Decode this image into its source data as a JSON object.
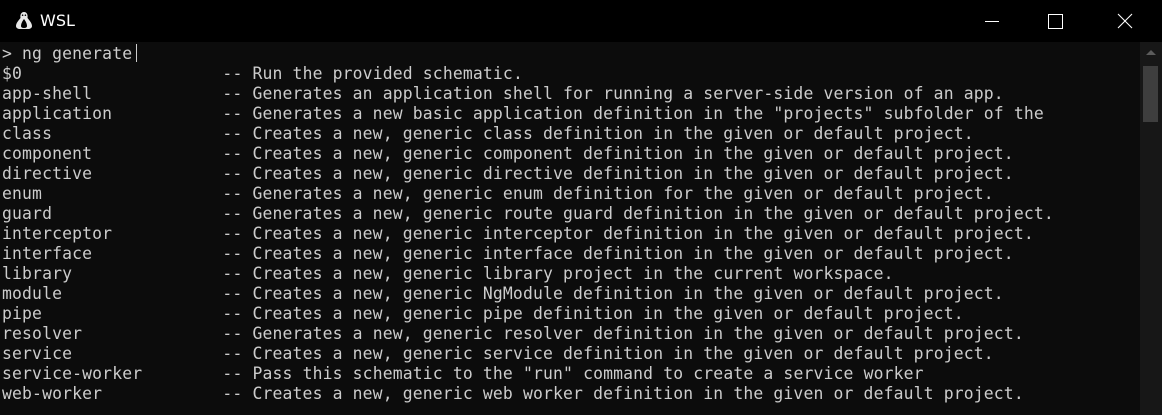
{
  "window": {
    "title": "WSL",
    "icon": "linux-penguin-icon",
    "controls": [
      "minimize",
      "maximize",
      "close"
    ]
  },
  "terminal": {
    "prompt": "> ng generate",
    "completions": [
      {
        "name": "$0",
        "desc": "-- Run the provided schematic."
      },
      {
        "name": "app-shell",
        "desc": "-- Generates an application shell for running a server-side version of an app."
      },
      {
        "name": "application",
        "desc": "-- Generates a new basic application definition in the \"projects\" subfolder of the"
      },
      {
        "name": "class",
        "desc": "-- Creates a new, generic class definition in the given or default project."
      },
      {
        "name": "component",
        "desc": "-- Creates a new, generic component definition in the given or default project."
      },
      {
        "name": "directive",
        "desc": "-- Creates a new, generic directive definition in the given or default project."
      },
      {
        "name": "enum",
        "desc": "-- Generates a new, generic enum definition for the given or default project."
      },
      {
        "name": "guard",
        "desc": "-- Generates a new, generic route guard definition in the given or default project."
      },
      {
        "name": "interceptor",
        "desc": "-- Creates a new, generic interceptor definition in the given or default project."
      },
      {
        "name": "interface",
        "desc": "-- Creates a new, generic interface definition in the given or default project."
      },
      {
        "name": "library",
        "desc": "-- Creates a new, generic library project in the current workspace."
      },
      {
        "name": "module",
        "desc": "-- Creates a new, generic NgModule definition in the given or default project."
      },
      {
        "name": "pipe",
        "desc": "-- Creates a new, generic pipe definition in the given or default project."
      },
      {
        "name": "resolver",
        "desc": "-- Generates a new, generic resolver definition in the given or default project."
      },
      {
        "name": "service",
        "desc": "-- Creates a new, generic service definition in the given or default project."
      },
      {
        "name": "service-worker",
        "desc": "-- Pass this schematic to the \"run\" command to create a service worker"
      },
      {
        "name": "web-worker",
        "desc": "-- Creates a new, generic web worker definition in the given or default project."
      }
    ]
  },
  "colors": {
    "background": "#0c0c0c",
    "foreground": "#cccccc",
    "titlebar": "#000000",
    "scrollbar_track": "#171717",
    "scrollbar_thumb": "#3e3e3e"
  }
}
